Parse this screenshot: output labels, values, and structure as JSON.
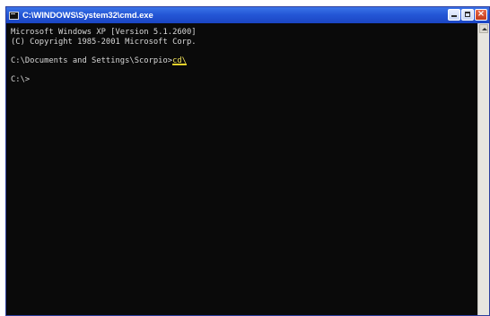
{
  "window": {
    "title": "C:\\WINDOWS\\System32\\cmd.exe",
    "title_color": "#ffffff",
    "titlebar_color": "#245edb",
    "console_bg": "#000000",
    "console_fg": "#c0c0c0"
  },
  "controls": {
    "minimize_icon": "minimize-icon",
    "maximize_icon": "maximize-icon",
    "close_icon": "close-icon",
    "close_glyph": "×"
  },
  "console": {
    "line1": "Microsoft Windows XP [Version 5.1.2600]",
    "line2": "(C) Copyright 1985-2001 Microsoft Corp.",
    "prompt1": "C:\\Documents and Settings\\Scorpio>",
    "command1": "cd\\",
    "prompt2": "C:\\>",
    "highlight_color": "#f2e25a"
  }
}
